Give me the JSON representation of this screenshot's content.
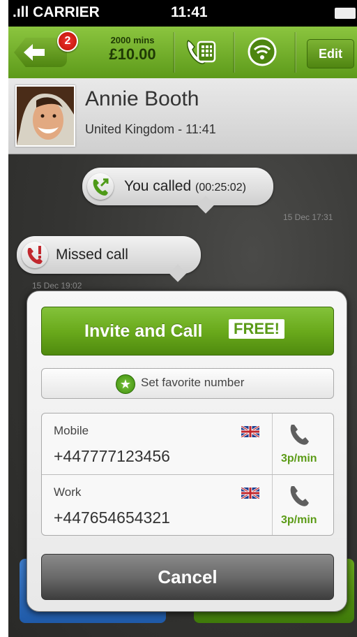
{
  "status_bar": {
    "carrier": ".ıll CARRIER",
    "time": "11:41"
  },
  "nav": {
    "badge_count": "2",
    "credit_minutes": "2000 mins",
    "credit_amount": "£10.00",
    "edit_label": "Edit",
    "back_icon": "back-arrow-icon",
    "dialpad_icon": "phone-keypad-icon",
    "wifi_icon": "wifi-call-icon"
  },
  "contact": {
    "name": "Annie Booth",
    "subtitle": "United Kingdom - 11:41"
  },
  "history": [
    {
      "text": "You called",
      "detail": "(00:25:02)",
      "timestamp": "15 Dec 17:31",
      "icon": "outgoing-call-icon"
    },
    {
      "text": "Missed call",
      "detail": "",
      "timestamp": "15 Dec 19:02",
      "icon": "missed-call-icon"
    }
  ],
  "modal": {
    "invite_label": "Invite and Call",
    "free_badge": "FREE!",
    "favorite_label": "Set favorite number",
    "numbers": [
      {
        "type": "Mobile",
        "number": "+447777123456",
        "rate": "3p/min",
        "flag": "uk-flag"
      },
      {
        "type": "Work",
        "number": "+447654654321",
        "rate": "3p/min",
        "flag": "uk-flag"
      }
    ],
    "cancel_label": "Cancel"
  },
  "colors": {
    "brand_green": "#6aaa1c",
    "missed_red": "#c1272d"
  }
}
